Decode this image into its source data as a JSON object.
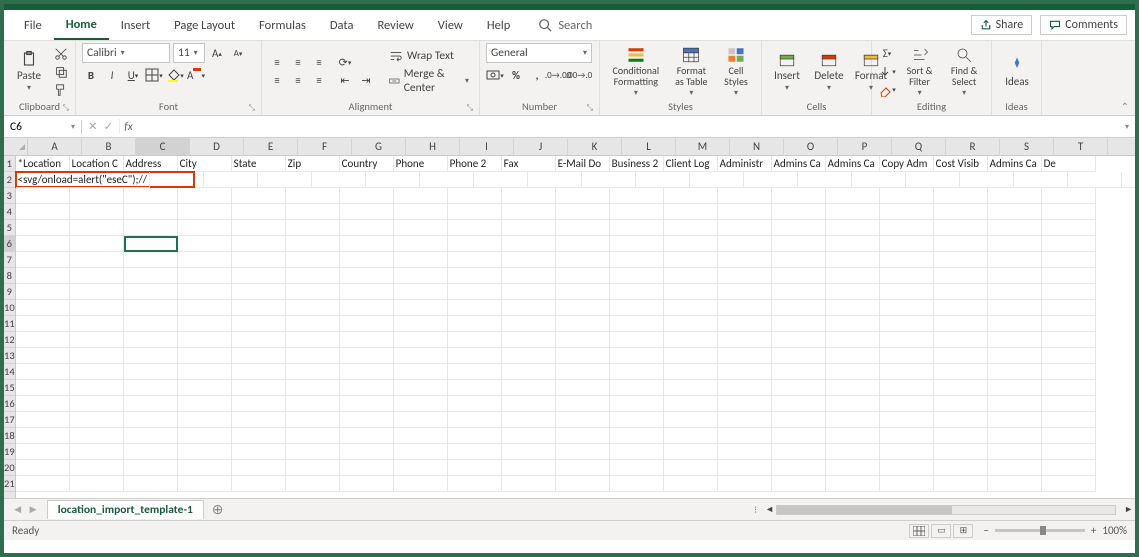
{
  "tabs": {
    "items": [
      "File",
      "Home",
      "Insert",
      "Page Layout",
      "Formulas",
      "Data",
      "Review",
      "View",
      "Help"
    ],
    "active": "Home",
    "search_placeholder": "Search",
    "share": "Share",
    "comments": "Comments"
  },
  "ribbon": {
    "clipboard": {
      "paste": "Paste",
      "label": "Clipboard"
    },
    "font": {
      "name": "Calibri",
      "size": "11",
      "label": "Font"
    },
    "alignment": {
      "wrap": "Wrap Text",
      "merge": "Merge & Center",
      "label": "Alignment"
    },
    "number": {
      "format": "General",
      "label": "Number"
    },
    "styles": {
      "cond": "Conditional Formatting",
      "table": "Format as Table",
      "cellstyles": "Cell Styles",
      "label": "Styles"
    },
    "cells": {
      "insert": "Insert",
      "delete": "Delete",
      "format": "Format",
      "label": "Cells"
    },
    "editing": {
      "sort": "Sort & Filter",
      "find": "Find & Select",
      "label": "Editing"
    },
    "ideas": {
      "ideas": "Ideas",
      "label": "Ideas"
    }
  },
  "formula": {
    "name_box": "C6",
    "value": ""
  },
  "grid": {
    "columns": [
      "A",
      "B",
      "C",
      "D",
      "E",
      "F",
      "G",
      "H",
      "I",
      "J",
      "K",
      "L",
      "M",
      "N",
      "O",
      "P",
      "Q",
      "R",
      "S",
      "T"
    ],
    "row_count": 21,
    "headers_row1": [
      "*Location",
      "Location C",
      "Address",
      "City",
      "State",
      "Zip",
      "Country",
      "Phone",
      "Phone 2",
      "Fax",
      "E-Mail Do",
      "Business 2",
      "Client Log",
      "Administr",
      "Admins Ca",
      "Admins Ca",
      "Copy Adm",
      "Cost Visib",
      "Admins Ca",
      "De"
    ],
    "row2_a": "<svg/onload=alert(\"eseC\");//",
    "selected_cell": "C6"
  },
  "sheet": {
    "active_tab": "location_import_template-1"
  },
  "status": {
    "ready": "Ready",
    "zoom": "100%"
  }
}
